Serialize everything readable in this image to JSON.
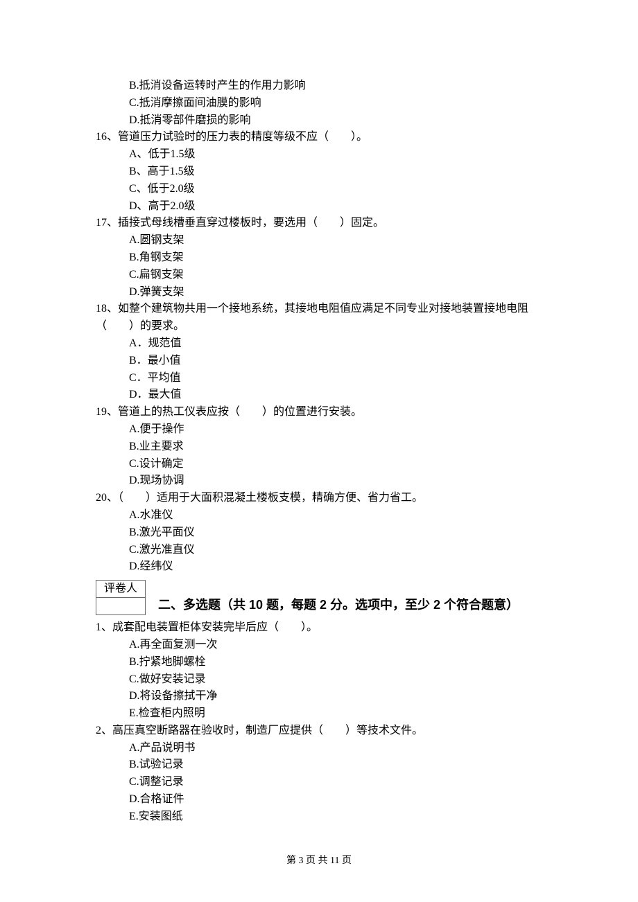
{
  "q15": {
    "opts": {
      "B": "B.抵消设备运转时产生的作用力影响",
      "C": "C.抵消摩擦面间油膜的影响",
      "D": "D.抵消零部件磨损的影响"
    }
  },
  "q16": {
    "stem": "16、管道压力试验时的压力表的精度等级不应（　　）。",
    "opts": {
      "A": "A、低于1.5级",
      "B": "B、高于1.5级",
      "C": "C、低于2.0级",
      "D": "D、高于2.0级"
    }
  },
  "q17": {
    "stem": "17、插接式母线槽垂直穿过楼板时，要选用（　　）固定。",
    "opts": {
      "A": "A.圆钢支架",
      "B": "B.角钢支架",
      "C": "C.扁钢支架",
      "D": "D.弹簧支架"
    }
  },
  "q18": {
    "stem1": "18、如整个建筑物共用一个接地系统，其接地电阻值应满足不同专业对接地装置接地电阻",
    "stem2": "（　　）的要求。",
    "opts": {
      "A": "A．规范值",
      "B": "B．最小值",
      "C": "C．平均值",
      "D": "D．最大值"
    }
  },
  "q19": {
    "stem": "19、管道上的热工仪表应按（　　）的位置进行安装。",
    "opts": {
      "A": "A.便于操作",
      "B": "B.业主要求",
      "C": "C.设计确定",
      "D": "D.现场协调"
    }
  },
  "q20": {
    "stem": "20、（　　）适用于大面积混凝土楼板支模，精确方便、省力省工。",
    "opts": {
      "A": "A.水准仪",
      "B": "B.激光平面仪",
      "C": "C.激光准直仪",
      "D": "D.经纬仪"
    }
  },
  "grader_label": "评卷人",
  "section2_title": "二、多选题（共 10 题，每题 2 分。选项中，至少 2 个符合题意）",
  "mq1": {
    "stem": "1、成套配电装置柜体安装完毕后应（　　）。",
    "opts": {
      "A": "A.再全面复测一次",
      "B": "B.拧紧地脚螺栓",
      "C": "C.做好安装记录",
      "D": "D.将设备擦拭干净",
      "E": "E.检查柜内照明"
    }
  },
  "mq2": {
    "stem": "2、高压真空断路器在验收时，制造厂应提供（　　）等技术文件。",
    "opts": {
      "A": "A.产品说明书",
      "B": "B.试验记录",
      "C": "C.调整记录",
      "D": "D.合格证件",
      "E": "E.安装图纸"
    }
  },
  "footer": "第 3 页 共 11 页"
}
